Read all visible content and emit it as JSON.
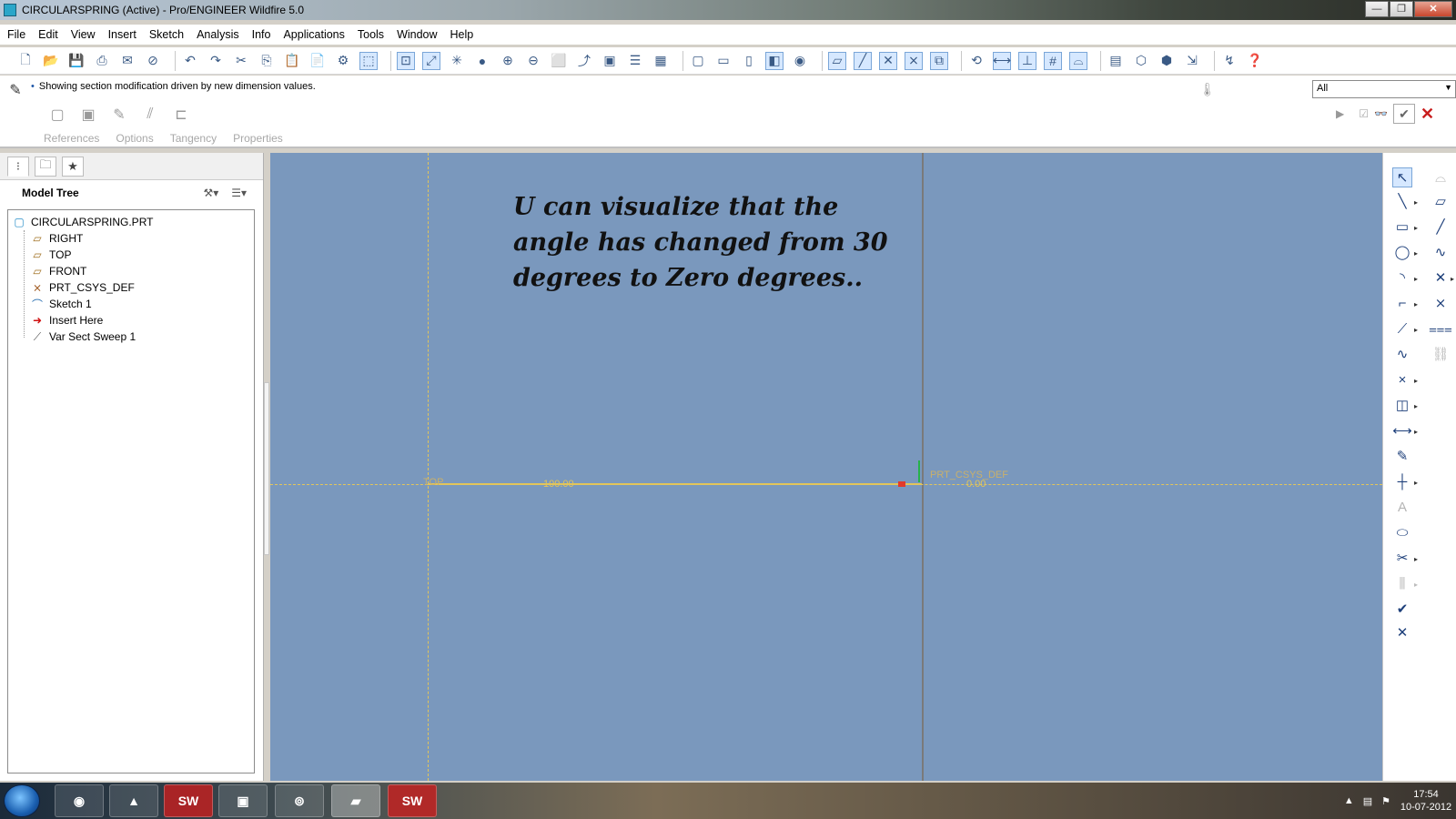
{
  "window": {
    "title": "CIRCULARSPRING (Active) - Pro/ENGINEER Wildfire 5.0",
    "controls": [
      "—",
      "❐",
      "✕"
    ]
  },
  "menu": [
    "File",
    "Edit",
    "View",
    "Insert",
    "Sketch",
    "Analysis",
    "Info",
    "Applications",
    "Tools",
    "Window",
    "Help"
  ],
  "dashboard": {
    "message": "Showing section modification driven by new dimension values.",
    "tabs": [
      "References",
      "Options",
      "Tangency",
      "Properties"
    ],
    "filter": {
      "selected": "All"
    }
  },
  "model_tree": {
    "title": "Model Tree",
    "root": "CIRCULARSPRING.PRT",
    "items": [
      {
        "label": "RIGHT",
        "icon": "datum-plane-icon"
      },
      {
        "label": "TOP",
        "icon": "datum-plane-icon"
      },
      {
        "label": "FRONT",
        "icon": "datum-plane-icon"
      },
      {
        "label": "PRT_CSYS_DEF",
        "icon": "csys-icon"
      },
      {
        "label": "Sketch 1",
        "icon": "sketch-icon"
      },
      {
        "label": "Insert Here",
        "icon": "insert-arrow-icon"
      },
      {
        "label": "Var Sect Sweep 1",
        "icon": "var-sect-sweep-icon"
      }
    ]
  },
  "canvas": {
    "note": "U can visualize that the angle has changed from 30 degrees to Zero degrees..",
    "dim_100": "100.00",
    "dim_0": "0.00",
    "top_label": "TOP",
    "csys_label": "PRT_CSYS_DEF"
  },
  "taskbar": {
    "apps": [
      "chrome-icon",
      "vlc-icon",
      "solidworks-icon",
      "window-icon",
      "browser-icon",
      "proe-icon",
      "solidworks-icon"
    ],
    "time": "17:54",
    "date": "10-07-2012"
  },
  "colors": {
    "canvas_bg": "#7a98bd",
    "sketch_line": "#e2c55a",
    "axis_line": "#7a7a7a",
    "accent": "#1f57a8"
  }
}
